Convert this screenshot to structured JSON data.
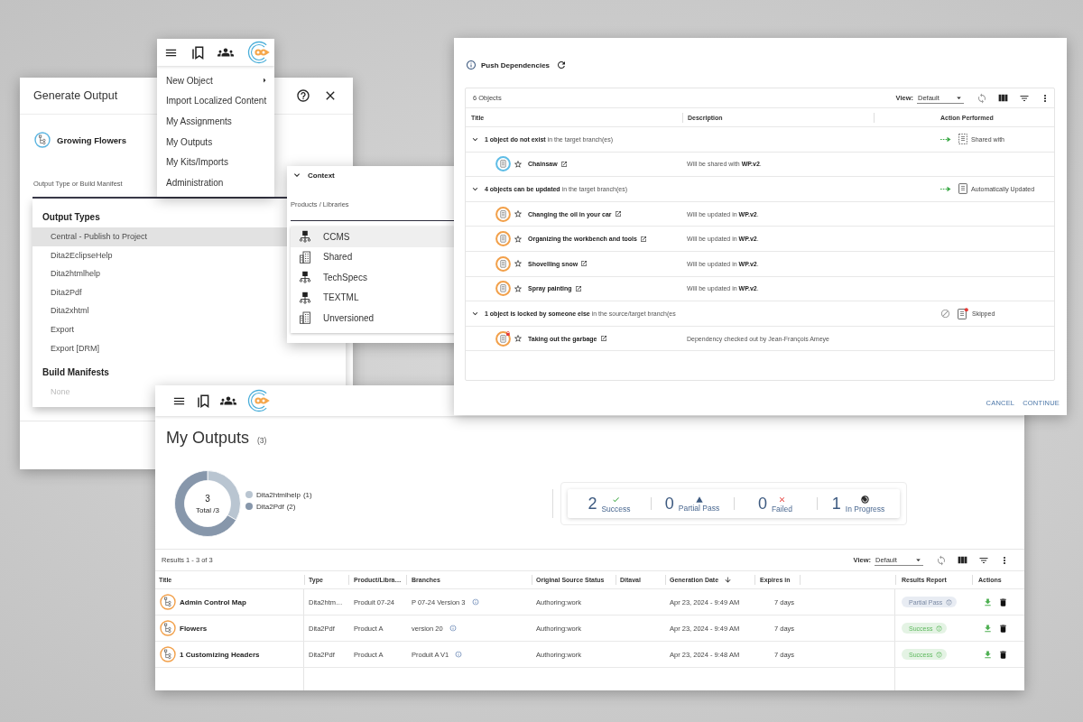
{
  "generate_output": {
    "title": "Generate Output",
    "item": "Growing Flowers",
    "field_label": "Output Type or Build Manifest",
    "option_groups": [
      {
        "heading": "Output Types",
        "options": [
          {
            "label": "Central - Publish to Project",
            "selected": true,
            "disabled": false
          },
          {
            "label": "Dita2EclipseHelp",
            "selected": false,
            "disabled": false
          },
          {
            "label": "Dita2htmlhelp",
            "selected": false,
            "disabled": false
          },
          {
            "label": "Dita2Pdf",
            "selected": false,
            "disabled": false
          },
          {
            "label": "Dita2xhtml",
            "selected": false,
            "disabled": false
          },
          {
            "label": "Export",
            "selected": false,
            "disabled": false
          },
          {
            "label": "Export [DRM]",
            "selected": false,
            "disabled": false
          }
        ]
      },
      {
        "heading": "Build Manifests",
        "options": [
          {
            "label": "None",
            "selected": false,
            "disabled": true
          }
        ]
      }
    ]
  },
  "main_menu": {
    "items": [
      {
        "label": "New Object",
        "submenu": true
      },
      {
        "label": "Import Localized Content",
        "submenu": false
      },
      {
        "label": "My Assignments",
        "submenu": false
      },
      {
        "label": "My Outputs",
        "submenu": false
      },
      {
        "label": "My Kits/Imports",
        "submenu": false
      },
      {
        "label": "Administration",
        "submenu": false
      }
    ]
  },
  "context_panel": {
    "title": "Context",
    "expanded": true,
    "field_label": "Products / Libraries",
    "options": [
      {
        "label": "CCMS",
        "kind": "network",
        "selected": true
      },
      {
        "label": "Shared",
        "kind": "library",
        "selected": false
      },
      {
        "label": "TechSpecs",
        "kind": "network",
        "selected": false
      },
      {
        "label": "TEXTML",
        "kind": "network",
        "selected": false
      },
      {
        "label": "Unversioned",
        "kind": "library",
        "selected": false
      }
    ]
  },
  "push_dependencies": {
    "title": "Push Dependencies",
    "count": "6 Objects",
    "view_label": "View:",
    "view_value": "Default",
    "columns": [
      "Title",
      "Description",
      "Action Performed"
    ],
    "groups": [
      {
        "summary": "**1 object do not exist** in the target branch(es)",
        "expanded": true,
        "kind": "shared",
        "action": "Shared with",
        "items": [
          {
            "title": "Chainsaw",
            "description": "Will be shared with **WP.v2**.",
            "color": "#5fbde6",
            "locked": false
          }
        ]
      },
      {
        "summary": "**4 objects can be updated** in the target branch(es)",
        "expanded": true,
        "kind": "updated",
        "action": "Automatically Updated",
        "items": [
          {
            "title": "Changing the oil in your car",
            "description": "Will be updated in **WP.v2**.",
            "color": "#f2a04a",
            "locked": false
          },
          {
            "title": "Organizing the workbench and tools",
            "description": "Will be updated in **WP.v2**.",
            "color": "#f2a04a",
            "locked": false
          },
          {
            "title": "Shovelling snow",
            "description": "Will be updated in **WP.v2**.",
            "color": "#f2a04a",
            "locked": false
          },
          {
            "title": "Spray painting",
            "description": "Will be updated in **WP.v2**.",
            "color": "#f2a04a",
            "locked": false
          }
        ]
      },
      {
        "summary": "**1 object is locked by someone else** in the source/target branch(es",
        "expanded": true,
        "kind": "skipped",
        "action": "Skipped",
        "items": [
          {
            "title": "Taking out the garbage",
            "description": "Dependency checked out by Jean-François Ameye",
            "color": "#f2a04a",
            "locked": true
          }
        ]
      }
    ],
    "buttons": [
      "CANCEL",
      "CONTINUE"
    ]
  },
  "my_outputs": {
    "title": "My Outputs",
    "count": "(3)",
    "donut": {
      "center_value": "3",
      "center_label": "Total /3",
      "legend": [
        {
          "count": "(1)",
          "color": "#b9c5d1"
        },
        {
          "count": "(2)",
          "color": "#8797ab"
        }
      ],
      "chart_data": {
        "type": "donut",
        "categories": [
          "Dita2htmlhelp",
          "Dita2Pdf"
        ],
        "values": [
          1,
          2
        ]
      }
    },
    "stats": [
      {
        "value": "2",
        "label": "Success",
        "kind": "success"
      },
      {
        "value": "0",
        "label": "Partial Pass",
        "kind": "partial"
      },
      {
        "value": "0",
        "label": "Failed",
        "kind": "failed"
      },
      {
        "value": "1",
        "label": "In Progress",
        "kind": "in_progress"
      }
    ],
    "results_label": "Results 1 - 3 of 3",
    "view_label": "View:",
    "view_value": "Default",
    "columns": [
      {
        "label": "Title",
        "sorted": false
      },
      {
        "label": "Type",
        "sorted": false
      },
      {
        "label": "Product/Libra…",
        "sorted": false
      },
      {
        "label": "Branches",
        "sorted": false
      },
      {
        "label": "Original Source Status",
        "sorted": false
      },
      {
        "label": "Ditaval",
        "sorted": false
      },
      {
        "label": "Generation Date",
        "sorted": true
      },
      {
        "label": "Expires in",
        "sorted": false
      },
      {
        "label": "Results Report",
        "sorted": false
      },
      {
        "label": "Actions",
        "sorted": false
      }
    ],
    "rows": [
      {
        "title": "Admin Control Map",
        "type": "Dita2htm…",
        "product": "Produit 07-24",
        "branch": "P 07-24 Version 3",
        "source_status": "Authoring:work",
        "generation_date": "Apr 23, 2024 - 9:49 AM",
        "expires": "7 days",
        "report": {
          "label": "Partial Pass",
          "kind": "partial"
        }
      },
      {
        "title": "Flowers",
        "type": "Dita2Pdf",
        "product": "Product A",
        "branch": "version 20",
        "source_status": "Authoring:work",
        "generation_date": "Apr 23, 2024 - 9:49 AM",
        "expires": "7 days",
        "report": {
          "label": "Success",
          "kind": "success"
        }
      },
      {
        "title": "1 Customizing Headers",
        "type": "Dita2Pdf",
        "product": "Product A",
        "branch": "Produit A V1",
        "source_status": "Authoring:work",
        "generation_date": "Apr 23, 2024 - 9:48 AM",
        "expires": "7 days",
        "report": {
          "label": "Success",
          "kind": "success"
        }
      }
    ]
  }
}
